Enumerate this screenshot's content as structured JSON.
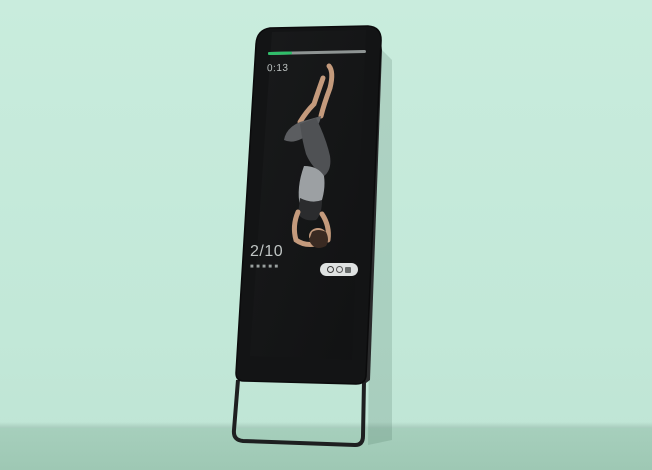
{
  "workout": {
    "timer": "0:13",
    "rep_count": "2/10",
    "rep_sub": "■ ■ ■ ■ ■",
    "progress": 0.24
  },
  "colors": {
    "progress_accent": "#2fbf6a",
    "screen": "#121314",
    "wall": "#c5ead9"
  },
  "icons": {
    "badge": "camera-toggle-icon"
  }
}
